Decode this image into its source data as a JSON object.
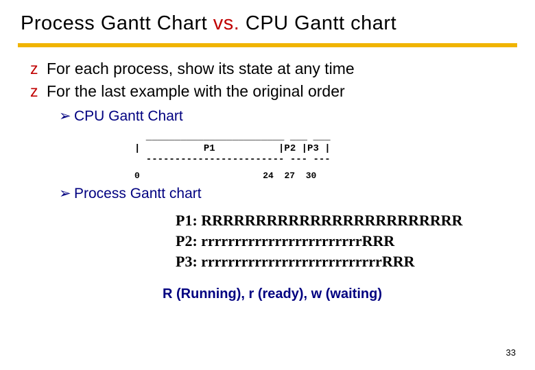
{
  "title": {
    "part1": "Process Gantt Chart ",
    "vs": "vs.",
    "part2": " CPU Gantt chart"
  },
  "bullets": {
    "z1": "For each process, show its state at any time",
    "z2": "For the last example with the original order"
  },
  "sub": {
    "s1": "CPU Gantt Chart",
    "s2": "Process Gantt chart"
  },
  "cpu_gantt": {
    "top": "  ________________________ ___ ___",
    "mid": "|           P1           |P2 |P3 |",
    "bot": "  ------------------------ --- ---",
    "ticks": {
      "t0": "0",
      "t1": "24",
      "t2": "27",
      "t3": "30"
    }
  },
  "proc_gantt": {
    "p1": "P1: RRRRRRRRRRRRRRRRRRRRRRRR",
    "p2": "P2: rrrrrrrrrrrrrrrrrrrrrrrrRRR",
    "p3": "P3: rrrrrrrrrrrrrrrrrrrrrrrrrrrRRR"
  },
  "legend": "R (Running), r (ready), w (waiting)",
  "pagenum": "33",
  "chart_data": {
    "type": "gantt",
    "cpu_schedule": [
      {
        "process": "P1",
        "start": 0,
        "end": 24
      },
      {
        "process": "P2",
        "start": 24,
        "end": 27
      },
      {
        "process": "P3",
        "start": 27,
        "end": 30
      }
    ],
    "process_states": {
      "P1": {
        "ready": [
          0,
          0
        ],
        "running": [
          0,
          24
        ]
      },
      "P2": {
        "ready": [
          0,
          24
        ],
        "running": [
          24,
          27
        ]
      },
      "P3": {
        "ready": [
          0,
          27
        ],
        "running": [
          27,
          30
        ]
      }
    },
    "legend": {
      "R": "Running",
      "r": "ready",
      "w": "waiting"
    },
    "time_range": [
      0,
      30
    ],
    "ticks": [
      0,
      24,
      27,
      30
    ]
  }
}
